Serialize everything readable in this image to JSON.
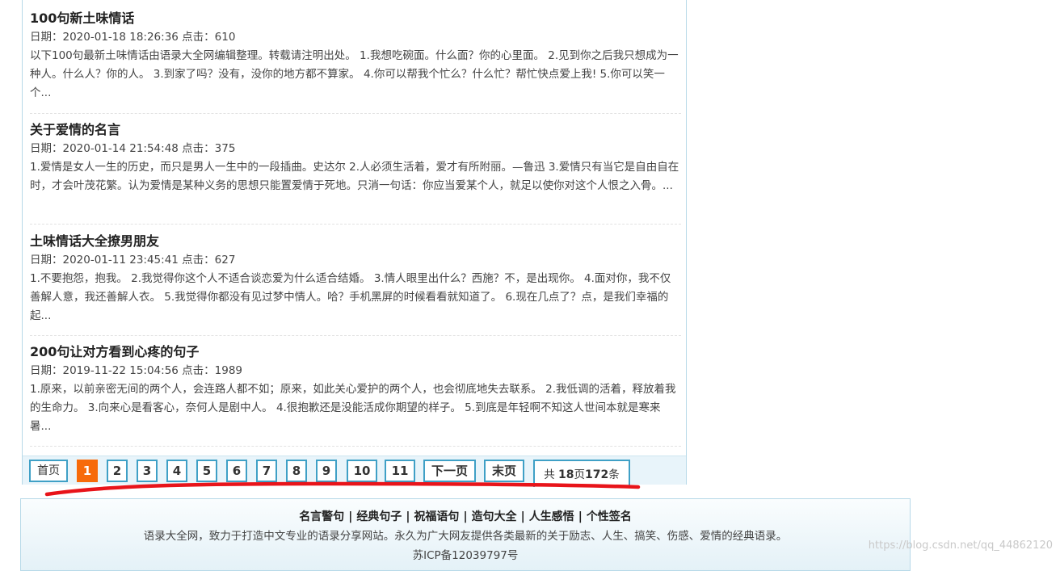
{
  "articles": [
    {
      "title": "100句新土味情话",
      "meta": "日期：2020-01-18 18:26:36 点击：610",
      "summary": "以下100句最新土味情话由语录大全网编辑整理。转载请注明出处。 1.我想吃碗面。什么面？你的心里面。 2.见到你之后我只想成为一种人。什么人？你的人。 3.到家了吗？没有，没你的地方都不算家。 4.你可以帮我个忙么？什么忙？帮忙快点爱上我! 5.你可以笑一个..."
    },
    {
      "title": "关于爱情的名言",
      "meta": "日期：2020-01-14 21:54:48 点击：375",
      "summary": "1.爱情是女人一生的历史，而只是男人一生中的一段插曲。史达尔 2.人必须生活着，爱才有所附丽。—鲁迅 3.爱情只有当它是自由自在时，才会叶茂花繁。认为爱情是某种义务的思想只能置爱情于死地。只消一句话：你应当爱某个人，就足以使你对这个人恨之入骨。..."
    },
    {
      "title": "土味情话大全撩男朋友",
      "meta": "日期：2020-01-11 23:45:41 点击：627",
      "summary": "1.不要抱怨，抱我。 2.我觉得你这个人不适合谈恋爱为什么适合结婚。 3.情人眼里出什么？西施？不，是出现你。 4.面对你，我不仅善解人意，我还善解人衣。 5.我觉得你都没有见过梦中情人。哈？手机黑屏的时候看看就知道了。 6.现在几点了？点，是我们幸福的起..."
    },
    {
      "title": "200句让对方看到心疼的句子",
      "meta": "日期：2019-11-22 15:04:56 点击：1989",
      "summary": "1.原来，以前亲密无间的两个人，会连路人都不如；原来，如此关心爱护的两个人，也会彻底地失去联系。 2.我低调的活着，释放着我的生命力。 3.向来心是看客心，奈何人是剧中人。 4.很抱歉还是没能活成你期望的样子。 5.到底是年轻啊不知这人世间本就是寒来暑..."
    }
  ],
  "pager": {
    "first": "首页",
    "pages": [
      "1",
      "2",
      "3",
      "4",
      "5",
      "6",
      "7",
      "8",
      "9",
      "10",
      "11"
    ],
    "current": "1",
    "next": "下一页",
    "last": "末页",
    "total_prefix": "共 ",
    "total_pages": "18",
    "total_pages_unit": "页",
    "total_items": "172",
    "total_items_unit": "条"
  },
  "footer": {
    "links": [
      "名言警句",
      "经典句子",
      "祝福语句",
      "造句大全",
      "人生感悟",
      "个性签名"
    ],
    "separator": "|",
    "description": "语录大全网，致力于打造中文专业的语录分享网站。永久为广大网友提供各类最新的关于励志、人生、搞笑、伤感、爱情的经典语录。",
    "icp": "苏ICP备12039797号"
  },
  "watermark": "https://blog.csdn.net/qq_44862120",
  "colors": {
    "border": "#3fa0c6",
    "current_page": "#f76a0a",
    "annotation_stroke": "#e8141a",
    "footer_bg": "#e4f1f7"
  }
}
